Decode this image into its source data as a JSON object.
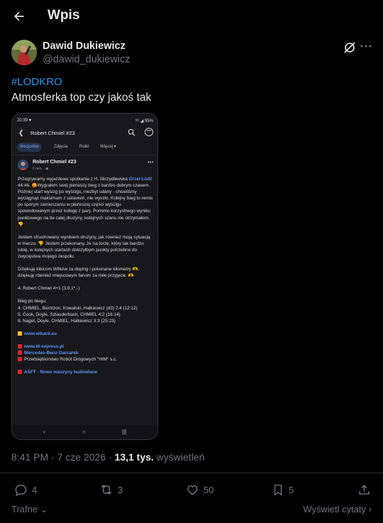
{
  "header": {
    "title": "Wpis"
  },
  "author": {
    "name": "Dawid Dukiewicz",
    "handle": "@dawid_dukiewicz"
  },
  "tweet": {
    "hashtag": "#LODKRO",
    "text": "Atmosferka top czy jakoś tak"
  },
  "screenshot": {
    "status_time": "20:39 ♥",
    "status_right": "⁵ᴳ ◢ 95%",
    "title": "Robert Chmiel #23",
    "tabs": [
      "Wszystkie",
      "Zdjęcia",
      "Rolki",
      "Więcej ▾"
    ],
    "post_author": "Robert Chmiel #23",
    "post_time": "6 min. · ◉",
    "body": {
      "p1_a": "Przegrywamy wyjazdowe spotkanie z H. Skrzydlewska",
      "p1_link": "Orzeł Łódź",
      "p1_b": " 44:46. 😡Wygrałem swój pierwszy bieg z bardzo dobrym czasem. Później start wyścig po wyścigu, niezbyt udany - chcieliśmy wyciągnąć maksimum z ustawień, nie wyszło. Kolejny bieg to remis po sporym zamieszaniu w pierwszej części wyścigu spowodowanym przez kolegę z pary. Pomimo korzystnego wyniku punktowego na tle całej drużyny, kolejnych szans nie otrzymałem. 👎",
      "p2": "Jestem sfrustrowany wynikiem drużyny, jak również moją sytuacją w meczu. 👎 Jestem przekonany, że na torze, który tak bardzo lubię, w kolejnych startach dołożyłbym punkty potrzebne do zwycięstwa mojego zespołu.",
      "p3": "Dziękuję kibicom Wilków za doping i pokonane kilometry 🫶, dziękuję również miejscowym fanom za miłe przyjęcie. 🫶",
      "p4": "4. Robert Chmiel 4+1 (3,0,1*,-)",
      "p5_title": "Bieg po biegu:",
      "p5_l1": "4. CHMIEL, Berntzon, Kowalski, Halkiewicz (d3) 2:4 (12:12)",
      "p5_l2": "5. Cook, Doyle, Szlauderbach, CHMIEL 4:2 (16:14)",
      "p5_l3": "8. Nagel, Doyle, CHMIEL, Halkiewicz 3:3 (25:23)",
      "s1": "www.wikard.eu",
      "s2": "www.ltl-express.pl",
      "s3": "Mercedes-Benz Garcarek",
      "s4": "Przedsiębiorstwo Robót Drogowych \"HIM\" s.c.",
      "s5": "ASFT - Nowe maszyny budowlane"
    },
    "nav": [
      "‹",
      "○",
      "|||"
    ]
  },
  "meta": {
    "time": "8:41 PM · 7 cze 2026 · ",
    "views_count": "13,1 tys.",
    "views_label": " wyświetleń"
  },
  "actions": {
    "replies": "4",
    "reposts": "3",
    "likes": "50",
    "bookmarks": "5"
  },
  "footer": {
    "sort": "Trafne",
    "quotes": "Wyświetl cytaty"
  },
  "colors": {
    "background": "#000000",
    "accent": "#1d9bf0",
    "muted": "#71767b",
    "text": "#e7e9ea"
  }
}
